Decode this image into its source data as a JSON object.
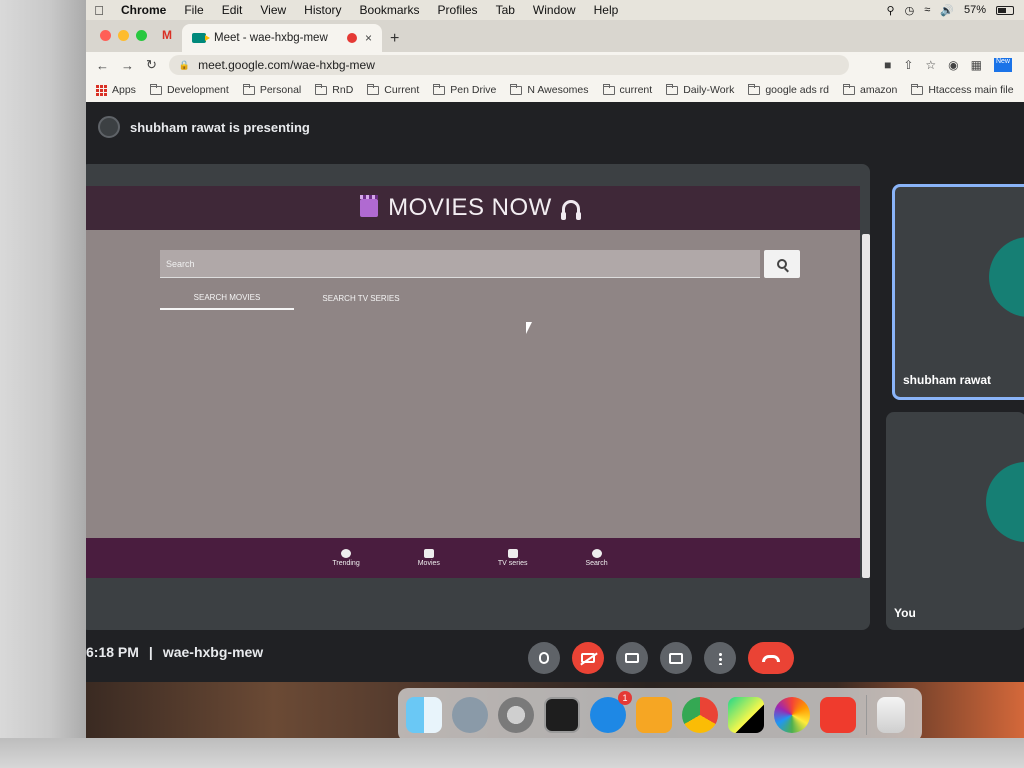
{
  "menubar": {
    "app": "Chrome",
    "items": [
      "File",
      "Edit",
      "View",
      "History",
      "Bookmarks",
      "Profiles",
      "Tab",
      "Window",
      "Help"
    ],
    "battery": "57%"
  },
  "browser": {
    "gmail_label": "M",
    "tab_title": "Meet - wae-hxbg-mew",
    "tab_close": "×",
    "new_tab": "+",
    "url": "meet.google.com/wae-hxbg-mew",
    "bookmarks": [
      "Apps",
      "Development",
      "Personal",
      "RnD",
      "Current",
      "Pen Drive",
      "N Awesomes",
      "current",
      "Daily-Work",
      "google ads rd",
      "amazon",
      "Htaccess main file"
    ],
    "new_badge": "New"
  },
  "meet": {
    "presenter_text": "shubham rawat is presenting",
    "time": "6:18 PM",
    "separator": "|",
    "meeting_code": "wae-hxbg-mew",
    "participants": [
      "shubham rawat",
      "You"
    ]
  },
  "shared_app": {
    "title": "MOVIES NOW",
    "search_placeholder": "Search",
    "tabs": [
      "SEARCH MOVIES",
      "SEARCH TV SERIES"
    ],
    "bottom_nav": [
      "Trending",
      "Movies",
      "TV series",
      "Search"
    ]
  },
  "dock": {
    "appstore_badge": "1",
    "apps": [
      "finder-icon",
      "launchpad-icon",
      "system-preferences-icon",
      "terminal-icon",
      "app-store-icon",
      "sublime-text-icon",
      "chrome-icon",
      "pycharm-icon",
      "photos-icon",
      "anydesk-icon",
      "trash-icon"
    ]
  }
}
